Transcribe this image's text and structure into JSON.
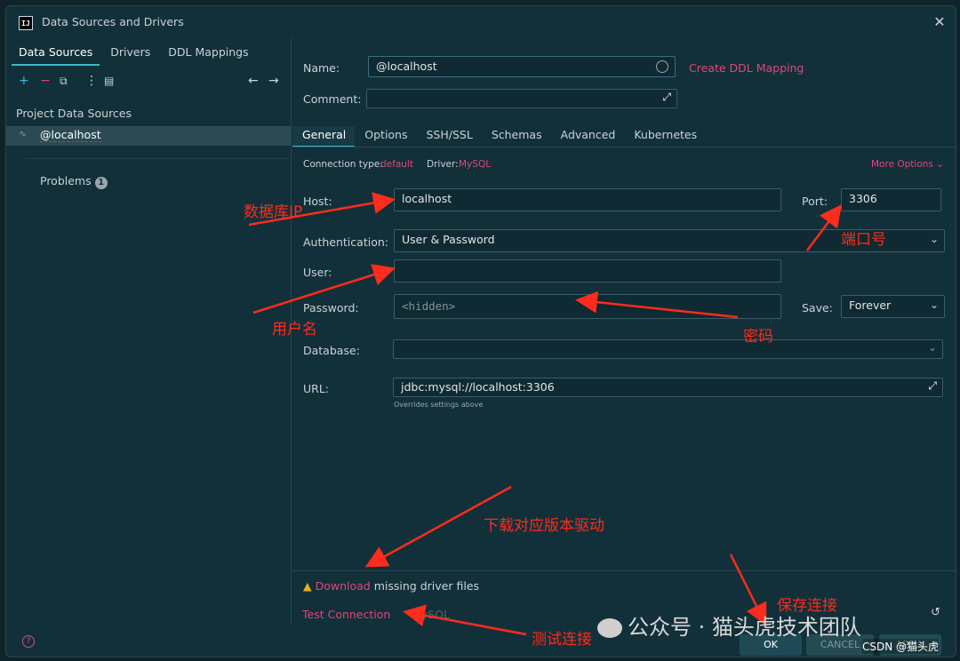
{
  "window": {
    "title": "Data Sources and Drivers",
    "app_icon_text": "IJ"
  },
  "left": {
    "tabs": [
      "Data Sources",
      "Drivers",
      "DDL Mappings"
    ],
    "toolbar_icons": [
      "add-icon",
      "remove-icon",
      "copy-icon",
      "more-icon",
      "import-icon",
      "back-icon",
      "forward-icon"
    ],
    "section": "Project Data Sources",
    "datasource": "@localhost",
    "problems": "Problems",
    "problems_count": "1"
  },
  "form": {
    "name_label": "Name:",
    "name_value": "@localhost",
    "create_ddl": "Create DDL Mapping",
    "comment_label": "Comment:",
    "tabs": [
      "General",
      "Options",
      "SSH/SSL",
      "Schemas",
      "Advanced",
      "Kubernetes"
    ],
    "conn_type_label": "Connection type:",
    "conn_type_value": "default",
    "driver_label": "Driver:",
    "driver_value": "MySQL",
    "more_options": "More Options",
    "host_label": "Host:",
    "host_value": "localhost",
    "port_label": "Port:",
    "port_value": "3306",
    "auth_label": "Authentication:",
    "auth_value": "User & Password",
    "user_label": "User:",
    "user_value": "",
    "password_label": "Password:",
    "password_placeholder": "<hidden>",
    "save_label": "Save:",
    "save_value": "Forever",
    "database_label": "Database:",
    "url_label": "URL:",
    "url_value": "jdbc:mysql://localhost:3306",
    "url_hint": "Overrides settings above"
  },
  "bottom": {
    "download_link": "Download",
    "download_rest": "missing driver files",
    "test_connection": "Test Connection",
    "test_driver": "MySQL",
    "ok": "OK",
    "cancel": "CANCEL",
    "apply": "APPLY"
  },
  "annotations": {
    "db_ip": "数据库IP",
    "port": "端口号",
    "username": "用户名",
    "password": "密码",
    "download_driver": "下载对应版本驱动",
    "save_connection": "保存连接",
    "test_connection": "测试连接"
  },
  "watermark": {
    "text": "公众号 · 猫头虎技术团队",
    "csdn": "CSDN @猫头虎"
  },
  "colors": {
    "accent": "#e0457b",
    "tab_underline": "#3fb7c9",
    "annotation": "#ff2b1c",
    "background": "#12303a"
  }
}
